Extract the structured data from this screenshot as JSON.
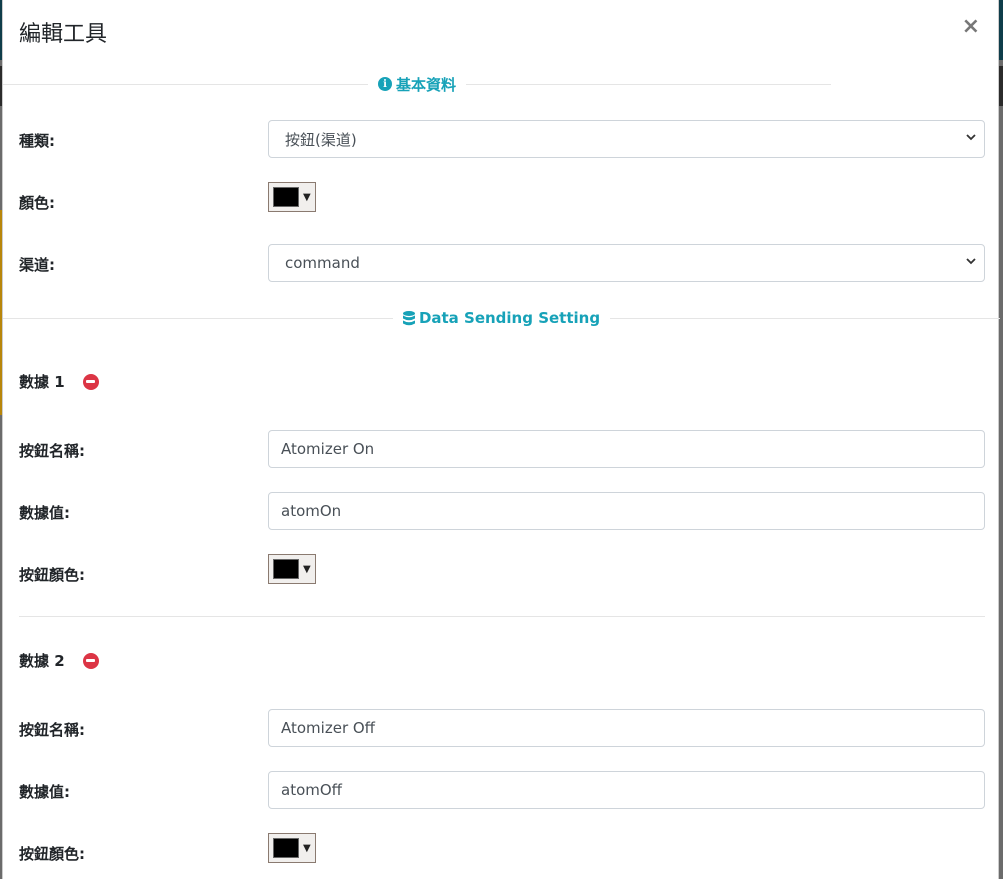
{
  "modal": {
    "title": "編輯工具",
    "close_symbol": "×"
  },
  "sections": {
    "basic": {
      "label": "基本資料",
      "icon": "info-icon"
    },
    "sending": {
      "label": "Data Sending Setting",
      "icon": "database-icon"
    }
  },
  "basic_fields": {
    "type": {
      "label": "種類:",
      "value": "按鈕(渠道)"
    },
    "color": {
      "label": "顏色:",
      "value": "#000000"
    },
    "channel": {
      "label": "渠道:",
      "value": "command"
    }
  },
  "data_items": [
    {
      "title": "數據 1",
      "name_label": "按鈕名稱:",
      "name_value": "Atomizer On",
      "value_label": "數據值:",
      "value_value": "atomOn",
      "color_label": "按鈕顏色:",
      "color_value": "#000000"
    },
    {
      "title": "數據 2",
      "name_label": "按鈕名稱:",
      "name_value": "Atomizer Off",
      "value_label": "數據值:",
      "value_value": "atomOff",
      "color_label": "按鈕顏色:",
      "color_value": "#000000"
    }
  ],
  "colors": {
    "accent": "#17a2b8",
    "danger": "#dc3545"
  }
}
